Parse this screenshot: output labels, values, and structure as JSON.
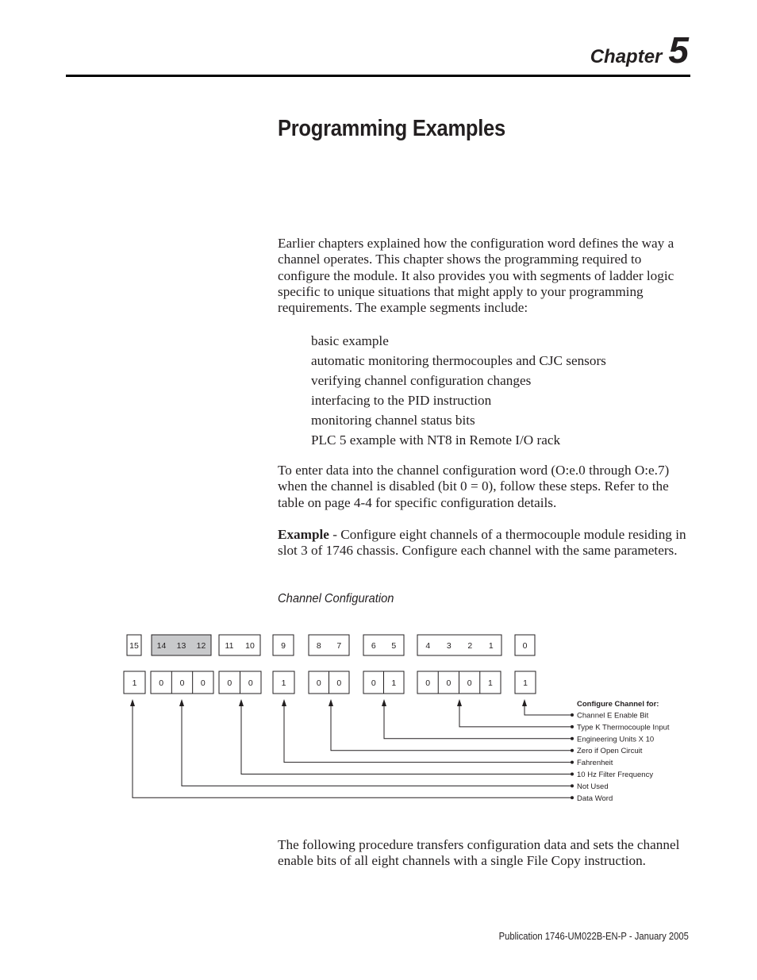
{
  "chapter": {
    "word": "Chapter",
    "number": "5"
  },
  "title": "Programming Examples",
  "intro": "Earlier chapters explained how the configuration word defines the way a channel operates. This chapter shows the programming required to configure the module. It also provides you with segments of ladder logic specific to unique situations that might apply to your programming requirements. The example segments include:",
  "segments": [
    "basic example",
    "automatic monitoring thermocouples and CJC sensors",
    "verifying channel configuration changes",
    "interfacing to the PID instruction",
    "monitoring channel status bits",
    "PLC 5 example with NT8 in Remote I/O rack"
  ],
  "steps_intro": "To enter data into the channel configuration word (O:e.0 through O:e.7) when the channel is disabled (bit 0 = 0), follow these steps. Refer to the table on page 4-4 for specific configuration details.",
  "example": {
    "label": "Example",
    "text": " - Configure eight channels of a thermocouple module residing in slot 3 of 1746 chassis. Configure each channel with the same parameters."
  },
  "figure": {
    "caption": "Channel Configuration",
    "groups": [
      {
        "bits": [
          "15"
        ],
        "values": [
          "1"
        ],
        "shaded": false
      },
      {
        "bits": [
          "14",
          "13",
          "12"
        ],
        "values": [
          "0",
          "0",
          "0"
        ],
        "shaded": true
      },
      {
        "bits": [
          "11",
          "10"
        ],
        "values": [
          "0",
          "0"
        ],
        "shaded": false
      },
      {
        "bits": [
          "9"
        ],
        "values": [
          "1"
        ],
        "shaded": false
      },
      {
        "bits": [
          "8",
          "7"
        ],
        "values": [
          "0",
          "0"
        ],
        "shaded": false
      },
      {
        "bits": [
          "6",
          "5"
        ],
        "values": [
          "0",
          "1"
        ],
        "shaded": false
      },
      {
        "bits": [
          "4",
          "3",
          "2",
          "1"
        ],
        "values": [
          "0",
          "0",
          "0",
          "1"
        ],
        "shaded": false
      },
      {
        "bits": [
          "0"
        ],
        "values": [
          "1"
        ],
        "shaded": false
      }
    ],
    "legend_title": "Configure Channel for:",
    "legend": [
      "Channel E Enable Bit",
      "Type K Thermocouple Input",
      "Engineering Units X 10",
      "Zero if Open Circuit",
      "Fahrenheit",
      "10 Hz Filter Frequency",
      "Not Used",
      "Data Word"
    ],
    "shade_color": "#c8c9cb"
  },
  "closing": "The following procedure transfers configuration data and sets the channel enable bits of all eight channels with a single File Copy instruction.",
  "footer": "Publication 1746-UM022B-EN-P - January 2005"
}
